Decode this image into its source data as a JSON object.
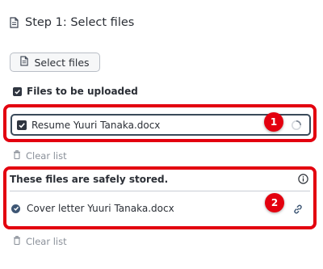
{
  "step": {
    "title": "Step 1: Select files",
    "icon": "document-icon"
  },
  "select_button": {
    "label": "Select files",
    "icon": "document-icon"
  },
  "upload_section": {
    "label": "Files to be uploaded",
    "checked": true,
    "items": [
      {
        "name": "Resume Yuuri Tanaka.docx",
        "checked": true,
        "status": "uploading",
        "status_icon": "spinner-icon"
      }
    ],
    "clear_label": "Clear list"
  },
  "stored_section": {
    "title": "These files are safely stored.",
    "info_icon": "info-icon",
    "items": [
      {
        "name": "Cover letter Yuuri Tanaka.docx",
        "status_icon": "check-circle-icon",
        "action_icon": "link-icon"
      }
    ],
    "clear_label": "Clear list"
  },
  "annotations": [
    "1",
    "2"
  ],
  "colors": {
    "annotation_red": "#e3000f",
    "text": "#2b2f36",
    "muted": "#8a9099",
    "check_fill": "#2f3540",
    "stored_check": "#3d5674"
  }
}
